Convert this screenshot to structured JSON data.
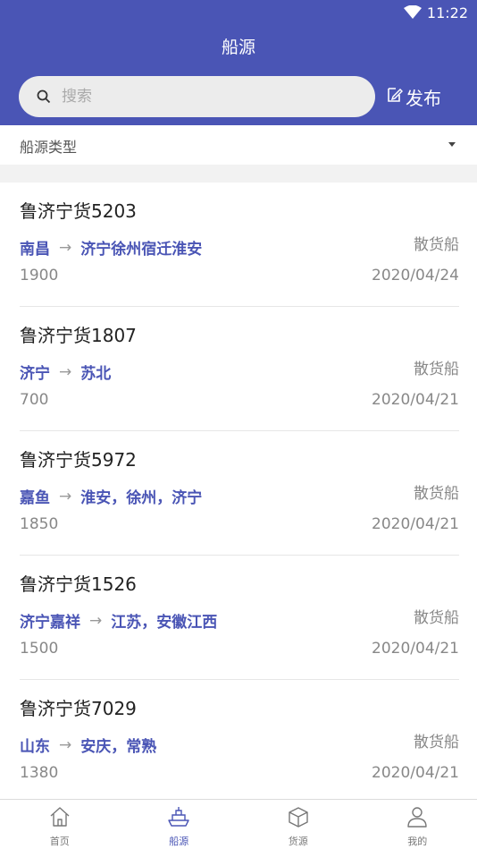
{
  "status_bar": {
    "time": "11:22"
  },
  "header": {
    "title": "船源",
    "search_placeholder": "搜索",
    "publish_label": "发布"
  },
  "filter": {
    "label": "船源类型"
  },
  "colors": {
    "primary": "#4a55b5",
    "muted": "#888888"
  },
  "ships": [
    {
      "name": "鲁济宁货5203",
      "from": "南昌",
      "to": "济宁徐州宿迁淮安",
      "type": "散货船",
      "tonnage": "1900",
      "date": "2020/04/24"
    },
    {
      "name": "鲁济宁货1807",
      "from": "济宁",
      "to": "苏北",
      "type": "散货船",
      "tonnage": "700",
      "date": "2020/04/21"
    },
    {
      "name": "鲁济宁货5972",
      "from": "嘉鱼",
      "to": "淮安，徐州，济宁",
      "type": "散货船",
      "tonnage": "1850",
      "date": "2020/04/21"
    },
    {
      "name": "鲁济宁货1526",
      "from": "济宁嘉祥",
      "to": "江苏，安徽江西",
      "type": "散货船",
      "tonnage": "1500",
      "date": "2020/04/21"
    },
    {
      "name": "鲁济宁货7029",
      "from": "山东",
      "to": "安庆，常熟",
      "type": "散货船",
      "tonnage": "1380",
      "date": "2020/04/21"
    }
  ],
  "tabbar": {
    "tabs": [
      {
        "label": "首页",
        "icon": "home-icon"
      },
      {
        "label": "船源",
        "icon": "ship-icon"
      },
      {
        "label": "货源",
        "icon": "box-icon"
      },
      {
        "label": "我的",
        "icon": "user-icon"
      }
    ]
  }
}
